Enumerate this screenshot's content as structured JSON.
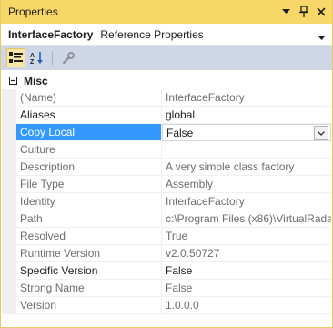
{
  "window": {
    "title": "Properties",
    "pin_icon": "pin-icon",
    "dropdown_icon": "window-dropdown-icon",
    "close_icon": "close-icon"
  },
  "object_selector": {
    "name": "InterfaceFactory",
    "type": "Reference Properties"
  },
  "toolbar": {
    "categorized_icon": "categorized-icon",
    "alphabetical_icon": "alphabetical-icon",
    "property_pages_icon": "wrench-icon"
  },
  "category": {
    "label": "Misc",
    "collapsed_icon": "minus-box-icon"
  },
  "properties": [
    {
      "name": "(Name)",
      "value": "InterfaceFactory"
    },
    {
      "name": "Aliases",
      "value": "global"
    },
    {
      "name": "Copy Local",
      "value": "False"
    },
    {
      "name": "Culture",
      "value": ""
    },
    {
      "name": "Description",
      "value": "A very simple class factory"
    },
    {
      "name": "File Type",
      "value": "Assembly"
    },
    {
      "name": "Identity",
      "value": "InterfaceFactory"
    },
    {
      "name": "Path",
      "value": "c:\\Program Files (x86)\\VirtualRada"
    },
    {
      "name": "Resolved",
      "value": "True"
    },
    {
      "name": "Runtime Version",
      "value": "v2.0.50727"
    },
    {
      "name": "Specific Version",
      "value": "False"
    },
    {
      "name": "Strong Name",
      "value": "False"
    },
    {
      "name": "Version",
      "value": "1.0.0.0"
    }
  ],
  "colors": {
    "titlebar": "#f7d767",
    "toolbar": "#cfd6e5",
    "selection": "#3399ff"
  }
}
